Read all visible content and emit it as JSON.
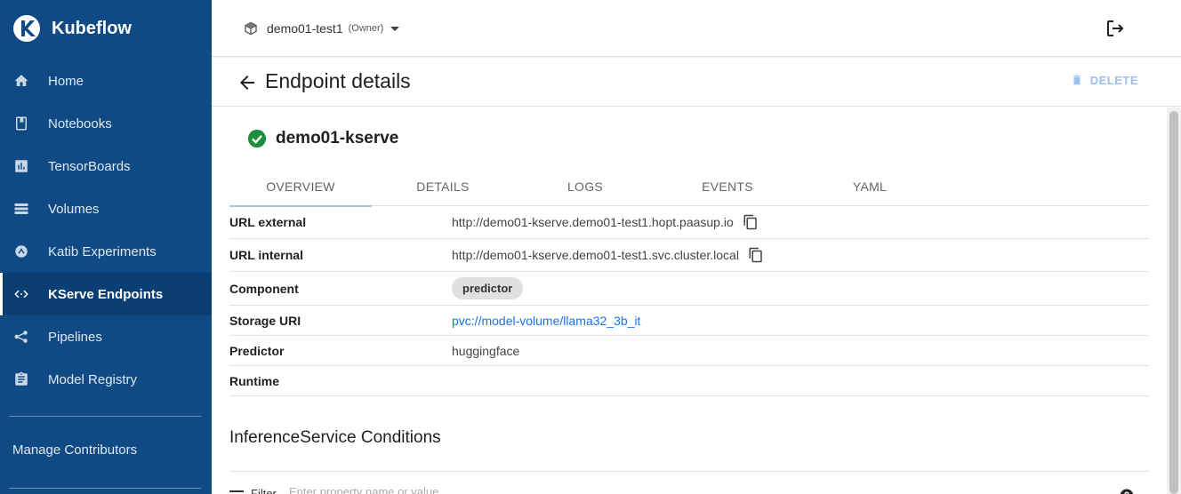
{
  "brand": {
    "name": "Kubeflow"
  },
  "sidebar": {
    "items": [
      {
        "label": "Home",
        "icon": "home-icon"
      },
      {
        "label": "Notebooks",
        "icon": "notebook-icon"
      },
      {
        "label": "TensorBoards",
        "icon": "chart-icon"
      },
      {
        "label": "Volumes",
        "icon": "storage-icon"
      },
      {
        "label": "Katib Experiments",
        "icon": "katib-icon"
      },
      {
        "label": "KServe Endpoints",
        "icon": "code-icon",
        "active": true
      },
      {
        "label": "Pipelines",
        "icon": "pipeline-icon"
      },
      {
        "label": "Model Registry",
        "icon": "clipboard-icon"
      }
    ],
    "manage_label": "Manage Contributors"
  },
  "topbar": {
    "namespace": "demo01-test1",
    "role": "(Owner)"
  },
  "header": {
    "title": "Endpoint details",
    "delete_label": "DELETE"
  },
  "endpoint": {
    "name": "demo01-kserve",
    "status": "ready"
  },
  "tabs": [
    "OVERVIEW",
    "DETAILS",
    "LOGS",
    "EVENTS",
    "YAML"
  ],
  "overview": {
    "rows": [
      {
        "key": "URL external",
        "value": "http://demo01-kserve.demo01-test1.hopt.paasup.io"
      },
      {
        "key": "URL internal",
        "value": "http://demo01-kserve.demo01-test1.svc.cluster.local"
      },
      {
        "key": "Component",
        "value": "predictor"
      },
      {
        "key": "Storage URI",
        "value": "pvc://model-volume/llama32_3b_it"
      },
      {
        "key": "Predictor",
        "value": "huggingface"
      },
      {
        "key": "Runtime",
        "value": ""
      }
    ]
  },
  "conditions": {
    "title": "InferenceService Conditions",
    "filter_label": "Filter",
    "filter_placeholder": "Enter property name or value"
  },
  "colors": {
    "sidebar_bg": "#0f4a85",
    "status_ok": "#1e8e3e",
    "link": "#1a73e8",
    "delete_disabled": "#9cc0ec"
  }
}
